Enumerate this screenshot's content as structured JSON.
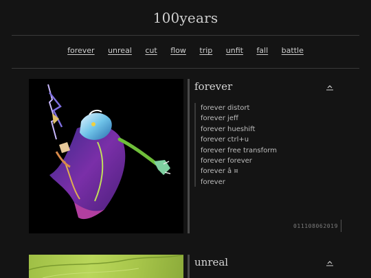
{
  "site": {
    "title": "100years"
  },
  "nav": {
    "items": [
      "forever",
      "unreal",
      "cut",
      "flow",
      "trip",
      "unfit",
      "fall",
      "battle"
    ]
  },
  "posts": [
    {
      "title": "forever",
      "image_icon": "abstract-figure-artwork",
      "tags": [
        "forever distort",
        "forever jeff",
        "forever hueshift",
        "forever ctrl+u",
        "forever free transform",
        "forever forever",
        "forever â    ¤",
        "forever"
      ],
      "id": "011108062019",
      "collapse_icon": "collapse-up-icon"
    },
    {
      "title": "unreal",
      "image_icon": "green-leaf-artwork",
      "collapse_icon": "collapse-up-icon"
    }
  ],
  "colors": {
    "background": "#141414",
    "text": "#cfcfcf",
    "rule": "#3a3a3a"
  }
}
